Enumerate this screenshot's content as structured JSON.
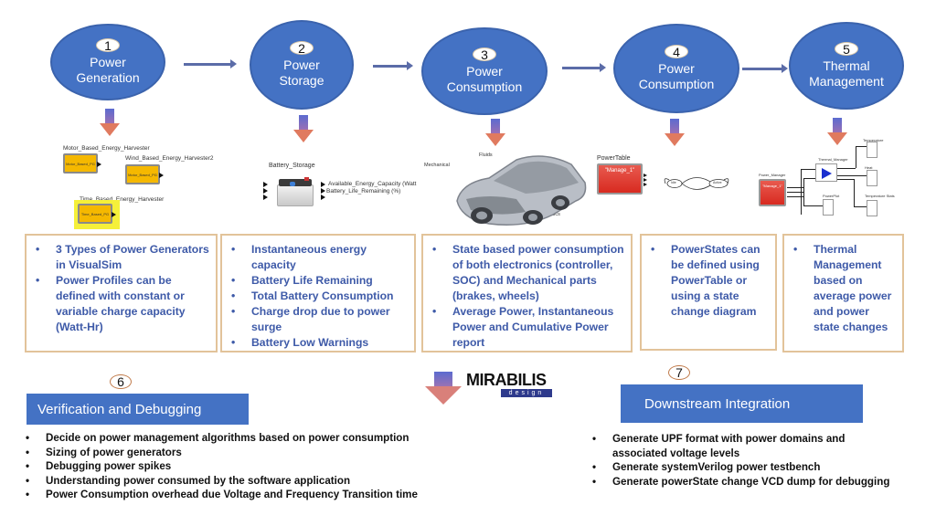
{
  "stages": [
    {
      "number": "1",
      "title_line1": "Power",
      "title_line2": "Generation"
    },
    {
      "number": "2",
      "title_line1": "Power",
      "title_line2": "Storage"
    },
    {
      "number": "3",
      "title_line1": "Power",
      "title_line2": "Consumption"
    },
    {
      "number": "4",
      "title_line1": "Power",
      "title_line2": "Consumption"
    },
    {
      "number": "5",
      "title_line1": "Thermal",
      "title_line2": "Management"
    }
  ],
  "illustrations": {
    "generation": {
      "motor_label": "Motor_Based_Energy_Harvester",
      "motor_block": "Motor_Based_PG",
      "wind_label": "Wind_Based_Energy_Harvester2",
      "wind_block": "Motor_Based_PG",
      "time_label": "Time_Based_Energy_Harvester",
      "time_block": "Time_Based_PG"
    },
    "storage": {
      "block_label": "Battery_Storage",
      "output1": "Available_Energy_Capacity (Watt",
      "output2": "Battery_Life_Remaining (%)"
    },
    "car": {
      "label_fluids": "Fluids",
      "label_mechanical": "Mechanical",
      "label_electronics": "Electronics"
    },
    "powertable": {
      "label": "PowerTable",
      "block_text": "\"Manage_1\"",
      "state_idle": "Idle",
      "state_active": "Active"
    },
    "thermal": {
      "power_manager_label": "Power_Manager",
      "power_manager_block": "\"Manage_1\"",
      "thermal_manager_label": "Thermal_Manager",
      "powerplot_label": "PowerPlot",
      "temperature_label": "Temperature",
      "heat_label": "Heat",
      "temperature_stats_label": "Temperature Stats"
    }
  },
  "info_boxes": [
    {
      "items": [
        "3 Types of Power Generators in VisualSim",
        "Power Profiles can be defined with constant or variable charge capacity (Watt-Hr)"
      ]
    },
    {
      "items": [
        "Instantaneous energy capacity",
        "Battery Life Remaining",
        "Total Battery Consumption",
        "Charge drop due to power surge",
        "Battery Low Warnings"
      ]
    },
    {
      "items": [
        "State based power consumption of both electronics (controller, SOC) and Mechanical parts (brakes, wheels)",
        "Average Power, Instantaneous Power and Cumulative Power report"
      ]
    },
    {
      "items": [
        "PowerStates can be defined using PowerTable or using a state change diagram"
      ]
    },
    {
      "items": [
        "Thermal Management based on average power and power state changes"
      ]
    }
  ],
  "verification": {
    "number": "6",
    "title": "Verification and Debugging",
    "items": [
      "Decide on power management algorithms based on power consumption",
      "Sizing of power generators",
      "Debugging power spikes",
      "Understanding power consumed by the software application",
      "Power Consumption overhead due Voltage and Frequency Transition time"
    ]
  },
  "downstream": {
    "number": "7",
    "title": "Downstream Integration",
    "items": [
      "Generate UPF format with power domains and associated voltage levels",
      "Generate systemVerilog power testbench",
      "Generate powerState change VCD dump for debugging"
    ]
  },
  "logo": {
    "name": "MIRABILIS",
    "tagline": "design"
  },
  "colors": {
    "stage_blue": "#4472c4",
    "box_border": "#e2c39a",
    "bullet_text": "#3e5aa8",
    "arrow_head": "#e07a5f"
  }
}
